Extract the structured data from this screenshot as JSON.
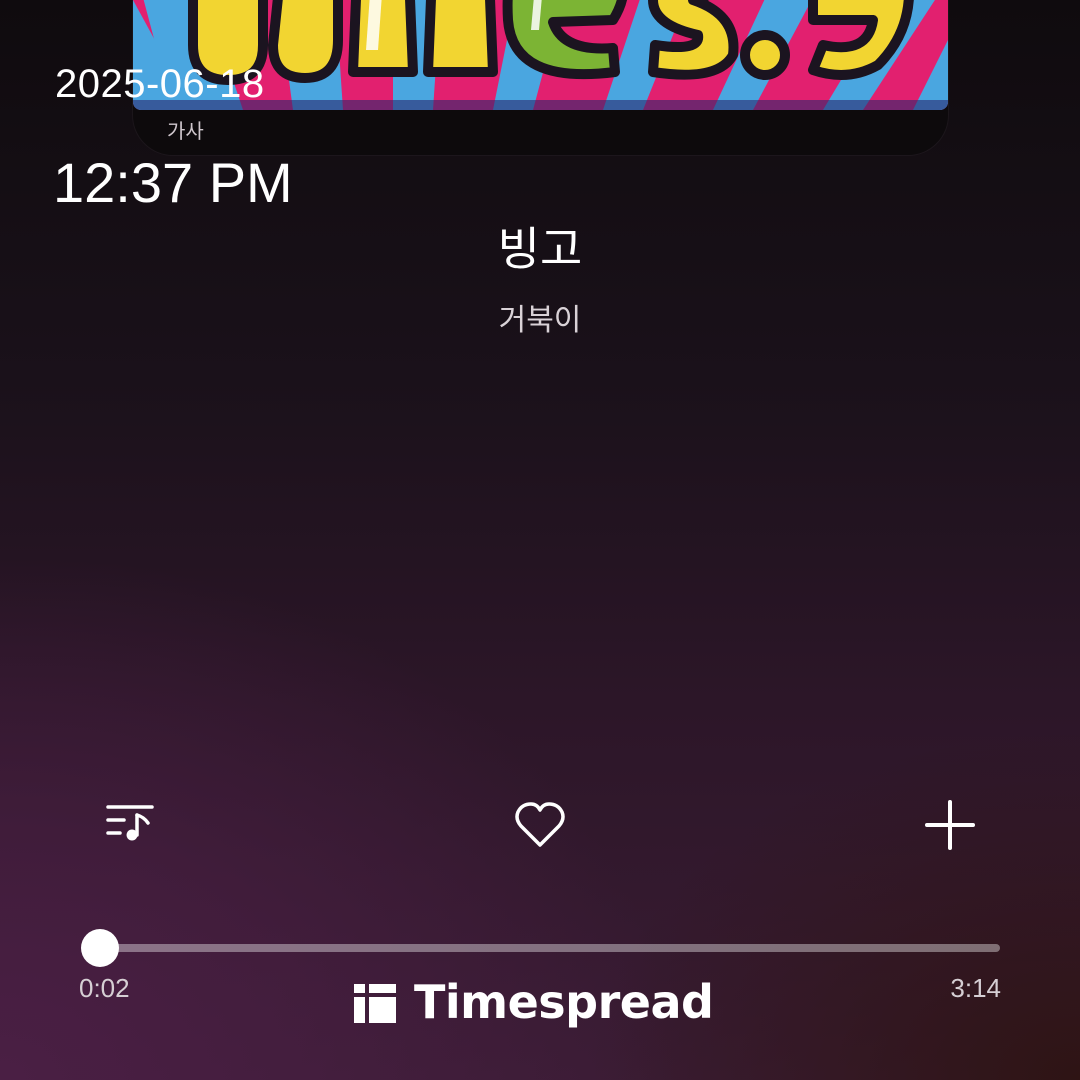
{
  "overlay": {
    "date": "2025-06-18",
    "time": "12:37 PM"
  },
  "album": {
    "art_icon": "album-cover-art",
    "lyrics_label": "가사"
  },
  "song": {
    "title": "빙고",
    "artist": "거북이"
  },
  "actions": {
    "queue_icon": "playlist-music-icon",
    "like_icon": "heart-outline-icon",
    "add_icon": "plus-icon"
  },
  "playback": {
    "elapsed": "0:02",
    "total": "3:14",
    "progress_fraction": 0.0107
  },
  "watermark": {
    "brand": "Timespread",
    "logo_icon": "timespread-logo-icon"
  },
  "colors": {
    "accent": "#ffffff",
    "track": "#8a7a86"
  }
}
